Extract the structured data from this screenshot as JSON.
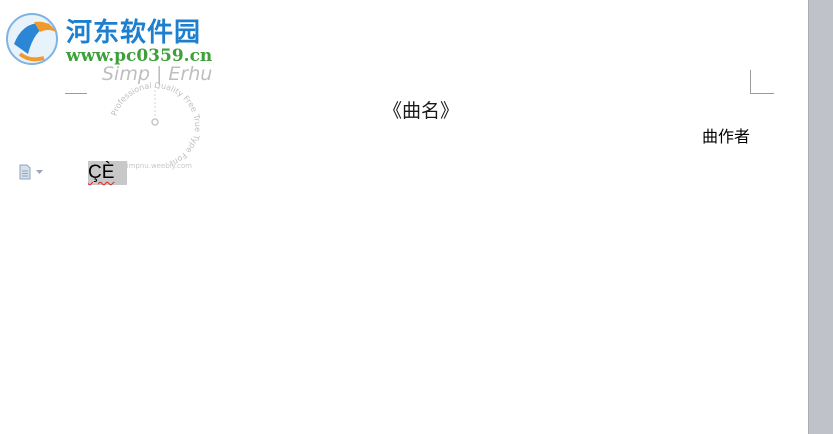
{
  "watermark": {
    "site_name": "河东软件园",
    "site_url": "www.pc0359.cn",
    "stamp": {
      "top_text": "Simp | Erhu",
      "ring_text": "Professional Quality Free True Type Font",
      "bottom_text": "simpnu.weebly.com"
    }
  },
  "document": {
    "title": "《曲名》",
    "composer": "曲作者",
    "selected_text": "ÇÈ"
  },
  "icons": {
    "paste_options": "clipboard-document-icon",
    "dropdown": "chevron-down-icon"
  },
  "colors": {
    "site_name": "#1e7fcf",
    "site_url": "#3da03a",
    "selection_highlight": "#c8c8c8",
    "spellcheck_underline": "#e02020",
    "scroll_gutter": "#bfc2c8"
  }
}
